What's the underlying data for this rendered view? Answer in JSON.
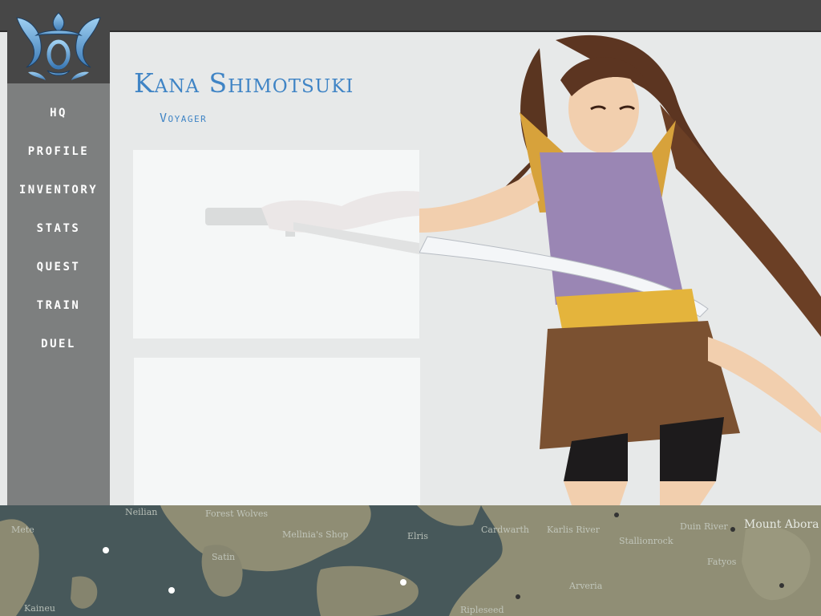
{
  "app": {
    "accent_color": "#3f84c5"
  },
  "logo": {
    "icon": "tribal-crest-logo"
  },
  "nav": {
    "items": [
      {
        "label": "HQ"
      },
      {
        "label": "PROFILE"
      },
      {
        "label": "INVENTORY"
      },
      {
        "label": "STATS"
      },
      {
        "label": "QUEST"
      },
      {
        "label": "TRAIN"
      },
      {
        "label": "DUEL"
      }
    ]
  },
  "character": {
    "name": "Kana Shimotsuki",
    "class": "Voyager"
  },
  "map": {
    "labels": [
      "Neilian",
      "Mete",
      "Forest Wolves",
      "Mellnia's Shop",
      "Satin",
      "Cardwarth",
      "Karlis River",
      "Stallionrock",
      "Duin River",
      "Mount Abora",
      "Fatyos",
      "Kaineu",
      "Arveria",
      "Ripleseed",
      "Elris"
    ]
  }
}
